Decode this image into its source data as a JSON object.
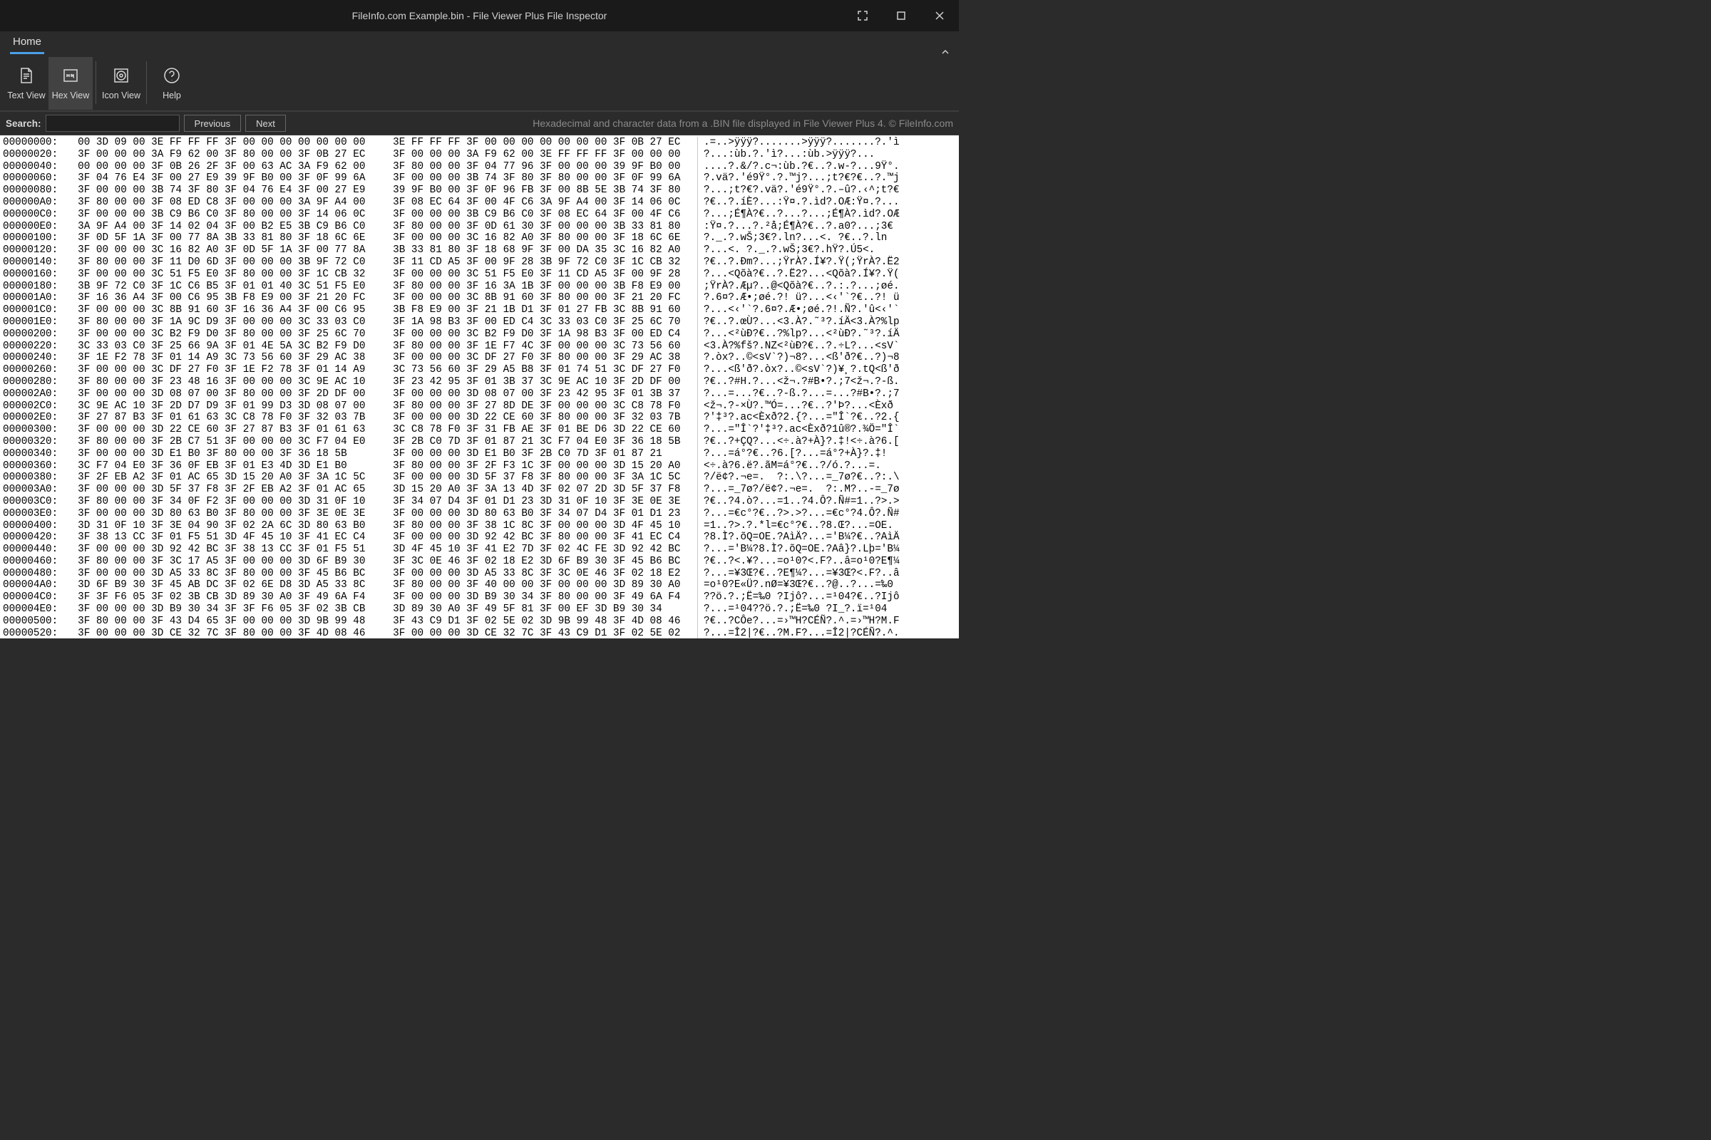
{
  "titlebar": {
    "title": "FileInfo.com Example.bin - File Viewer Plus File Inspector"
  },
  "tabs": {
    "home": "Home"
  },
  "ribbon": {
    "text_view": "Text View",
    "hex_view": "Hex View",
    "icon_view": "Icon View",
    "help": "Help"
  },
  "searchbar": {
    "label": "Search:",
    "value": "",
    "previous": "Previous",
    "next": "Next",
    "info": "Hexadecimal and character data from a .BIN file displayed in File Viewer Plus 4. © FileInfo.com"
  },
  "hex_rows": [
    {
      "offset": "00000000:",
      "b1": "00 3D 09 00 3E FF FF FF 3F 00 00 00 00 00 00 00",
      "b2": "3E FF FF FF 3F 00 00 00 00 00 00 00 3F 0B 27 EC",
      "asc": ".=..>ÿÿÿ?.......>ÿÿÿ?.......?.'ì"
    },
    {
      "offset": "00000020:",
      "b1": "3F 00 00 00 3A F9 62 00 3F 80 00 00 3F 0B 27 EC",
      "b2": "3F 00 00 00 3A F9 62 00 3E FF FF FF 3F 00 00 00",
      "asc": "?...:ùb.?.'ì?...:ùb.>ÿÿÿ?..."
    },
    {
      "offset": "00000040:",
      "b1": "00 00 00 00 3F 0B 26 2F 3F 00 63 AC 3A F9 62 00",
      "b2": "3F 80 00 00 3F 04 77 96 3F 00 00 00 39 9F B0 00",
      "asc": "....?.&/?.c¬:ùb.?€..?.w-?...9Ÿ°."
    },
    {
      "offset": "00000060:",
      "b1": "3F 04 76 E4 3F 00 27 E9 39 9F B0 00 3F 0F 99 6A",
      "b2": "3F 00 00 00 3B 74 3F 80 3F 80 00 00 3F 0F 99 6A",
      "asc": "?.vä?.'é9Ÿ°.?.™j?...;t?€?€..?.™j"
    },
    {
      "offset": "00000080:",
      "b1": "3F 00 00 00 3B 74 3F 80 3F 04 76 E4 3F 00 27 E9",
      "b2": "39 9F B0 00 3F 0F 96 FB 3F 00 8B 5E 3B 74 3F 80",
      "asc": "?...;t?€?.vä?.'é9Ÿ°.?.–û?.‹^;t?€"
    },
    {
      "offset": "000000A0:",
      "b1": "3F 80 00 00 3F 08 ED C8 3F 00 00 00 3A 9F A4 00",
      "b2": "3F 08 EC 64 3F 00 4F C6 3A 9F A4 00 3F 14 06 0C",
      "asc": "?€..?.íÈ?...:Ÿ¤.?.ìd?.OÆ:Ÿ¤.?..."
    },
    {
      "offset": "000000C0:",
      "b1": "3F 00 00 00 3B C9 B6 C0 3F 80 00 00 3F 14 06 0C",
      "b2": "3F 00 00 00 3B C9 B6 C0 3F 08 EC 64 3F 00 4F C6",
      "asc": "?...;É¶À?€..?...?...;É¶À?.ìd?.OÆ"
    },
    {
      "offset": "000000E0:",
      "b1": "3A 9F A4 00 3F 14 02 04 3F 00 B2 E5 3B C9 B6 C0",
      "b2": "3F 80 00 00 3F 0D 61 30 3F 00 00 00 3B 33 81 80",
      "asc": ":Ÿ¤.?...?.²å;É¶À?€..?.a0?...;3€"
    },
    {
      "offset": "00000100:",
      "b1": "3F 0D 5F 1A 3F 00 77 8A 3B 33 81 80 3F 18 6C 6E",
      "b2": "3F 00 00 00 3C 16 82 A0 3F 80 00 00 3F 18 6C 6E",
      "asc": "?._.?.wŠ;3€?.ln?...<. ?€..?.ln"
    },
    {
      "offset": "00000120:",
      "b1": "3F 00 00 00 3C 16 82 A0 3F 0D 5F 1A 3F 00 77 8A",
      "b2": "3B 33 81 80 3F 18 68 9F 3F 00 DA 35 3C 16 82 A0",
      "asc": "?...<. ?._.?.wŠ;3€?.hŸ?.Ú5<. "
    },
    {
      "offset": "00000140:",
      "b1": "3F 80 00 00 3F 11 D0 6D 3F 00 00 00 3B 9F 72 C0",
      "b2": "3F 11 CD A5 3F 00 9F 28 3B 9F 72 C0 3F 1C CB 32",
      "asc": "?€..?.Ðm?...;ŸrÀ?.Í¥?.Ÿ(;ŸrÀ?.Ë2"
    },
    {
      "offset": "00000160:",
      "b1": "3F 00 00 00 3C 51 F5 E0 3F 80 00 00 3F 1C CB 32",
      "b2": "3F 00 00 00 3C 51 F5 E0 3F 11 CD A5 3F 00 9F 28",
      "asc": "?...<Qõà?€..?.Ë2?...<Qõà?.Í¥?.Ÿ("
    },
    {
      "offset": "00000180:",
      "b1": "3B 9F 72 C0 3F 1C C6 B5 3F 01 01 40 3C 51 F5 E0",
      "b2": "3F 80 00 00 3F 16 3A 1B 3F 00 00 00 3B F8 E9 00",
      "asc": ";ŸrÀ?.Æµ?..@<Qõà?€..?.:.?...;øé."
    },
    {
      "offset": "000001A0:",
      "b1": "3F 16 36 A4 3F 00 C6 95 3B F8 E9 00 3F 21 20 FC",
      "b2": "3F 00 00 00 3C 8B 91 60 3F 80 00 00 3F 21 20 FC",
      "asc": "?.6¤?.Æ•;øé.?! ü?...<‹'`?€..?! ü"
    },
    {
      "offset": "000001C0:",
      "b1": "3F 00 00 00 3C 8B 91 60 3F 16 36 A4 3F 00 C6 95",
      "b2": "3B F8 E9 00 3F 21 1B D1 3F 01 27 FB 3C 8B 91 60",
      "asc": "?...<‹'`?.6¤?.Æ•;øé.?!.Ñ?.'û<‹'`"
    },
    {
      "offset": "000001E0:",
      "b1": "3F 80 00 00 3F 1A 9C D9 3F 00 00 00 3C 33 03 C0",
      "b2": "3F 1A 98 B3 3F 00 ED C4 3C 33 03 C0 3F 25 6C 70",
      "asc": "?€..?.œÙ?...<3.À?.˜³?.íÄ<3.À?%lp"
    },
    {
      "offset": "00000200:",
      "b1": "3F 00 00 00 3C B2 F9 D0 3F 80 00 00 3F 25 6C 70",
      "b2": "3F 00 00 00 3C B2 F9 D0 3F 1A 98 B3 3F 00 ED C4",
      "asc": "?...<²ùÐ?€..?%lp?...<²ùÐ?.˜³?.íÄ"
    },
    {
      "offset": "00000220:",
      "b1": "3C 33 03 C0 3F 25 66 9A 3F 01 4E 5A 3C B2 F9 D0",
      "b2": "3F 80 00 00 3F 1E F7 4C 3F 00 00 00 3C 73 56 60",
      "asc": "<3.À?%fš?.NZ<²ùÐ?€..?.÷L?...<sV`"
    },
    {
      "offset": "00000240:",
      "b1": "3F 1E F2 78 3F 01 14 A9 3C 73 56 60 3F 29 AC 38",
      "b2": "3F 00 00 00 3C DF 27 F0 3F 80 00 00 3F 29 AC 38",
      "asc": "?.òx?..©<sV`?)¬8?...<ß'ð?€..?)¬8"
    },
    {
      "offset": "00000260:",
      "b1": "3F 00 00 00 3C DF 27 F0 3F 1E F2 78 3F 01 14 A9",
      "b2": "3C 73 56 60 3F 29 A5 B8 3F 01 74 51 3C DF 27 F0",
      "asc": "?...<ß'ð?.òx?..©<sV`?)¥¸?.tQ<ß'ð"
    },
    {
      "offset": "00000280:",
      "b1": "3F 80 00 00 3F 23 48 16 3F 00 00 00 3C 9E AC 10",
      "b2": "3F 23 42 95 3F 01 3B 37 3C 9E AC 10 3F 2D DF 00",
      "asc": "?€..?#H.?...<ž¬.?#B•?.;7<ž¬.?-ß."
    },
    {
      "offset": "000002A0:",
      "b1": "3F 00 00 00 3D 08 07 00 3F 80 00 00 3F 2D DF 00",
      "b2": "3F 00 00 00 3D 08 07 00 3F 23 42 95 3F 01 3B 37",
      "asc": "?...=...?€..?-ß.?...=...?#B•?.;7"
    },
    {
      "offset": "000002C0:",
      "b1": "3C 9E AC 10 3F 2D D7 D9 3F 01 99 D3 3D 08 07 00",
      "b2": "3F 80 00 00 3F 27 8D DE 3F 00 00 00 3C C8 78 F0",
      "asc": "<ž¬.?-×Ù?.™Ó=...?€..?'Þ?...<Èxð"
    },
    {
      "offset": "000002E0:",
      "b1": "3F 27 87 B3 3F 01 61 63 3C C8 78 F0 3F 32 03 7B",
      "b2": "3F 00 00 00 3D 22 CE 60 3F 80 00 00 3F 32 03 7B",
      "asc": "?'‡³?.ac<Èxð?2.{?...=\"Î`?€..?2.{"
    },
    {
      "offset": "00000300:",
      "b1": "3F 00 00 00 3D 22 CE 60 3F 27 87 B3 3F 01 61 63",
      "b2": "3C C8 78 F0 3F 31 FB AE 3F 01 BE D6 3D 22 CE 60",
      "asc": "?...=\"Î`?'‡³?.ac<Èxð?1û®?.¾Ö=\"Î`"
    },
    {
      "offset": "00000320:",
      "b1": "3F 80 00 00 3F 2B C7 51 3F 00 00 00 3C F7 04 E0",
      "b2": "3F 2B C0 7D 3F 01 87 21 3C F7 04 E0 3F 36 18 5B",
      "asc": "?€..?+ÇQ?...<÷.à?+À}?.‡!<÷.à?6.["
    },
    {
      "offset": "00000340:",
      "b1": "3F 00 00 00 3D E1 B0 3F 80 00 00 3F 36 18 5B",
      "b2": "3F 00 00 00 3D E1 B0 3F 2B C0 7D 3F 01 87 21",
      "asc": "?...=á°?€..?6.[?...=á°?+À}?.‡!"
    },
    {
      "offset": "00000360:",
      "b1": "3C F7 04 E0 3F 36 0F EB 3F 01 E3 4D 3D E1 B0",
      "b2": "3F 80 00 00 3F 2F F3 1C 3F 00 00 00 3D 15 20 A0",
      "asc": "<÷.à?6.ë?.ãM=á°?€..?/ó.?...=.  "
    },
    {
      "offset": "00000380:",
      "b1": "3F 2F EB A2 3F 01 AC 65 3D 15 20 A0 3F 3A 1C 5C",
      "b2": "3F 00 00 00 3D 5F 37 F8 3F 80 00 00 3F 3A 1C 5C",
      "asc": "?/ë¢?.¬e=.  ?:.\\?...=_7ø?€..?:.\\"
    },
    {
      "offset": "000003A0:",
      "b1": "3F 00 00 00 3D 5F 37 F8 3F 2F EB A2 3F 01 AC 65",
      "b2": "3D 15 20 A0 3F 3A 13 4D 3F 02 07 2D 3D 5F 37 F8",
      "asc": "?...=_7ø?/ë¢?.¬e=.  ?:.M?..-=_7ø"
    },
    {
      "offset": "000003C0:",
      "b1": "3F 80 00 00 3F 34 0F F2 3F 00 00 00 3D 31 0F 10",
      "b2": "3F 34 07 D4 3F 01 D1 23 3D 31 0F 10 3F 3E 0E 3E",
      "asc": "?€..?4.ò?...=1..?4.Ô?.Ñ#=1..?>.>"
    },
    {
      "offset": "000003E0:",
      "b1": "3F 00 00 00 3D 80 63 B0 3F 80 00 00 3F 3E 0E 3E",
      "b2": "3F 00 00 00 3D 80 63 B0 3F 34 07 D4 3F 01 D1 23",
      "asc": "?...=€c°?€..?>.>?...=€c°?4.Ô?.Ñ#"
    },
    {
      "offset": "00000400:",
      "b1": "3D 31 0F 10 3F 3E 04 90 3F 02 2A 6C 3D 80 63 B0",
      "b2": "3F 80 00 00 3F 38 1C 8C 3F 00 00 00 3D 4F 45 10",
      "asc": "=1..?>.?.*l=€c°?€..?8.Œ?...=OE."
    },
    {
      "offset": "00000420:",
      "b1": "3F 38 13 CC 3F 01 F5 51 3D 4F 45 10 3F 41 EC C4",
      "b2": "3F 00 00 00 3D 92 42 BC 3F 80 00 00 3F 41 EC C4",
      "asc": "?8.Ì?.õQ=OE.?AìÄ?...='B¼?€..?AìÄ"
    },
    {
      "offset": "00000440:",
      "b1": "3F 00 00 00 3D 92 42 BC 3F 38 13 CC 3F 01 F5 51",
      "b2": "3D 4F 45 10 3F 41 E2 7D 3F 02 4C FE 3D 92 42 BC",
      "asc": "?...='B¼?8.Ì?.õQ=OE.?Aâ}?.Lþ='B¼"
    },
    {
      "offset": "00000460:",
      "b1": "3F 80 00 00 3F 3C 17 A5 3F 00 00 00 3D 6F B9 30",
      "b2": "3F 3C 0E 46 3F 02 18 E2 3D 6F B9 30 3F 45 B6 BC",
      "asc": "?€..?<.¥?...=o¹0?<.F?..â=o¹0?E¶¼"
    },
    {
      "offset": "00000480:",
      "b1": "3F 00 00 00 3D A5 33 8C 3F 80 00 00 3F 45 B6 BC",
      "b2": "3F 00 00 00 3D A5 33 8C 3F 3C 0E 46 3F 02 18 E2",
      "asc": "?...=¥3Œ?€..?E¶¼?...=¥3Œ?<.F?..â"
    },
    {
      "offset": "000004A0:",
      "b1": "3D 6F B9 30 3F 45 AB DC 3F 02 6E D8 3D A5 33 8C",
      "b2": "3F 80 00 00 3F 40 00 00 3F 00 00 00 3D 89 30 A0",
      "asc": "=o¹0?E«Ü?.nØ=¥3Œ?€..?@..?...=‰0 "
    },
    {
      "offset": "000004C0:",
      "b1": "3F 3F F6 05 3F 02 3B CB 3D 89 30 A0 3F 49 6A F4",
      "b2": "3F 00 00 00 3D B9 30 34 3F 80 00 00 3F 49 6A F4",
      "asc": "??ö.?.;Ë=‰0 ?Ijô?...=¹04?€..?Ijô"
    },
    {
      "offset": "000004E0:",
      "b1": "3F 00 00 00 3D B9 30 34 3F 3F F6 05 3F 02 3B CB",
      "b2": "3D 89 30 A0 3F 49 5F 81 3F 00 EF 3D B9 30 34",
      "asc": "?...=¹04??ö.?.;Ë=‰0 ?I_?.ï=¹04"
    },
    {
      "offset": "00000500:",
      "b1": "3F 80 00 00 3F 43 D4 65 3F 00 00 00 3D 9B 99 48",
      "b2": "3F 43 C9 D1 3F 02 5E 02 3D 9B 99 48 3F 4D 08 46",
      "asc": "?€..?CÔe?...=›™H?CÉÑ?.^.=›™H?M.F"
    },
    {
      "offset": "00000520:",
      "b1": "3F 00 00 00 3D CE 32 7C 3F 80 00 00 3F 4D 08 46",
      "b2": "3F 00 00 00 3D CE 32 7C 3F 43 C9 D1 3F 02 5E 02",
      "asc": "?...=Î2|?€..?M.F?...=Î2|?CÉÑ?.^."
    }
  ]
}
